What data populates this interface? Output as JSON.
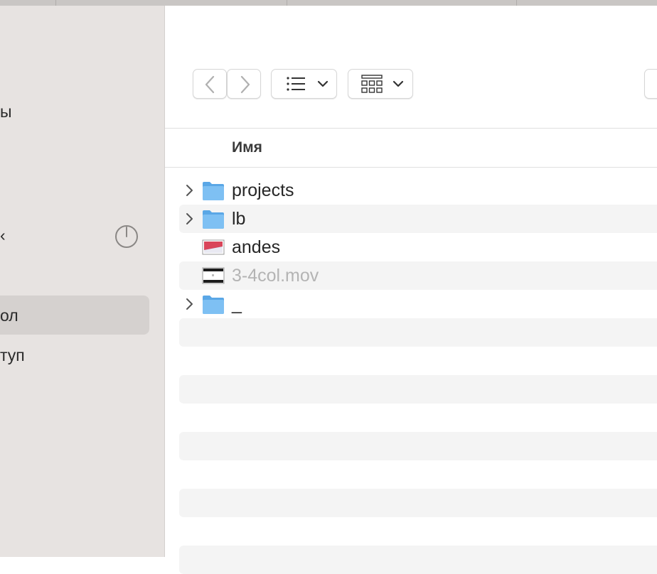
{
  "sidebar": {
    "items": [
      {
        "label": "ы"
      },
      {
        "label": "‹"
      },
      {
        "label": "ол",
        "selected": true
      },
      {
        "label": "туп"
      }
    ],
    "gauge_icon": "disk-usage-gauge-icon"
  },
  "toolbar": {
    "back_icon": "chevron-left-icon",
    "forward_icon": "chevron-right-icon",
    "view_icon": "list-view-icon",
    "group_icon": "grid-group-icon",
    "dropdown_icon": "chevron-down-icon"
  },
  "list": {
    "column_name": "Имя",
    "rows": [
      {
        "name": "projects",
        "type": "folder",
        "expandable": true,
        "dimmed": false
      },
      {
        "name": "lb",
        "type": "folder",
        "expandable": true,
        "dimmed": false
      },
      {
        "name": "andes",
        "type": "image",
        "expandable": false,
        "dimmed": false
      },
      {
        "name": "3-4col.mov",
        "type": "video",
        "expandable": false,
        "dimmed": true
      },
      {
        "name": "_",
        "type": "folder",
        "expandable": true,
        "dimmed": false
      }
    ]
  },
  "colors": {
    "sidebar_bg": "#e7e3e1",
    "sidebar_selected": "#d5d1cf",
    "stripe": "#f4f4f4",
    "folder_blue": "#6db5ef"
  }
}
